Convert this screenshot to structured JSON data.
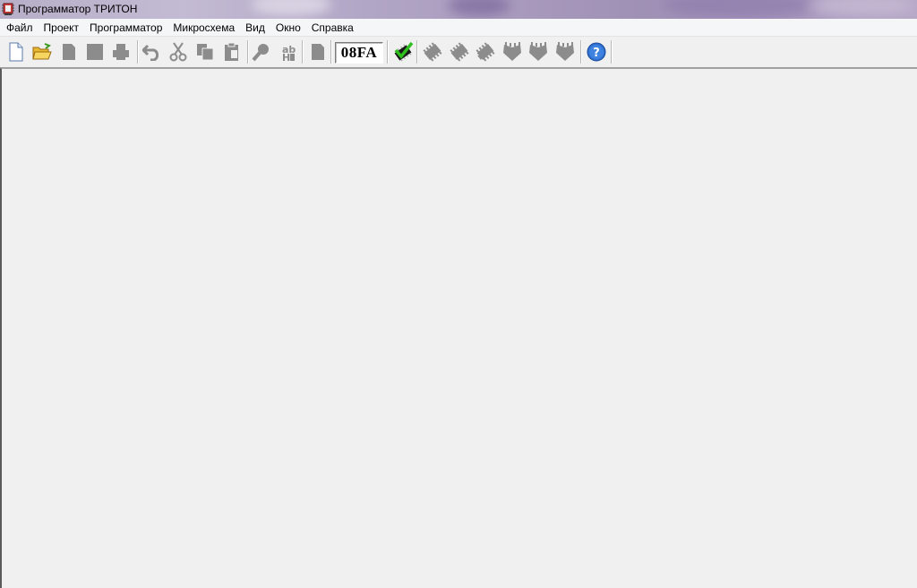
{
  "window": {
    "title": "Программатор ТРИТОН",
    "app_icon": "chip-programmer-icon"
  },
  "menu": {
    "items": [
      {
        "label": "Файл"
      },
      {
        "label": "Проект"
      },
      {
        "label": "Программатор"
      },
      {
        "label": "Микросхема"
      },
      {
        "label": "Вид"
      },
      {
        "label": "Окно"
      },
      {
        "label": "Справка"
      }
    ]
  },
  "toolbar": {
    "checksum_value": "08FA",
    "buttons": [
      {
        "icon": "new-file-icon",
        "enabled": true
      },
      {
        "icon": "open-folder-icon",
        "enabled": true
      },
      {
        "icon": "save-icon",
        "enabled": false
      },
      {
        "icon": "save-all-icon",
        "enabled": false
      },
      {
        "icon": "print-icon",
        "enabled": false
      },
      {
        "icon": "undo-icon",
        "enabled": false
      },
      {
        "icon": "cut-icon",
        "enabled": false
      },
      {
        "icon": "copy-icon",
        "enabled": false
      },
      {
        "icon": "paste-icon",
        "enabled": false
      },
      {
        "icon": "find-icon",
        "enabled": false
      },
      {
        "icon": "replace-icon",
        "enabled": false
      },
      {
        "icon": "buffer-icon",
        "enabled": false
      },
      {
        "icon": "chip-check-icon",
        "enabled": true
      },
      {
        "icon": "chip-read-icon",
        "enabled": false
      },
      {
        "icon": "chip-blank-check-icon",
        "enabled": false
      },
      {
        "icon": "chip-program-icon",
        "enabled": false
      },
      {
        "icon": "chip-verify-icon",
        "enabled": false
      },
      {
        "icon": "chip-erase-icon",
        "enabled": false
      },
      {
        "icon": "chip-auto-icon",
        "enabled": false
      },
      {
        "icon": "help-icon",
        "enabled": true
      }
    ]
  },
  "colors": {
    "disabled_icon": "#8c8c8c",
    "help_blue": "#2f6fd0",
    "check_green": "#2fbf1f"
  }
}
